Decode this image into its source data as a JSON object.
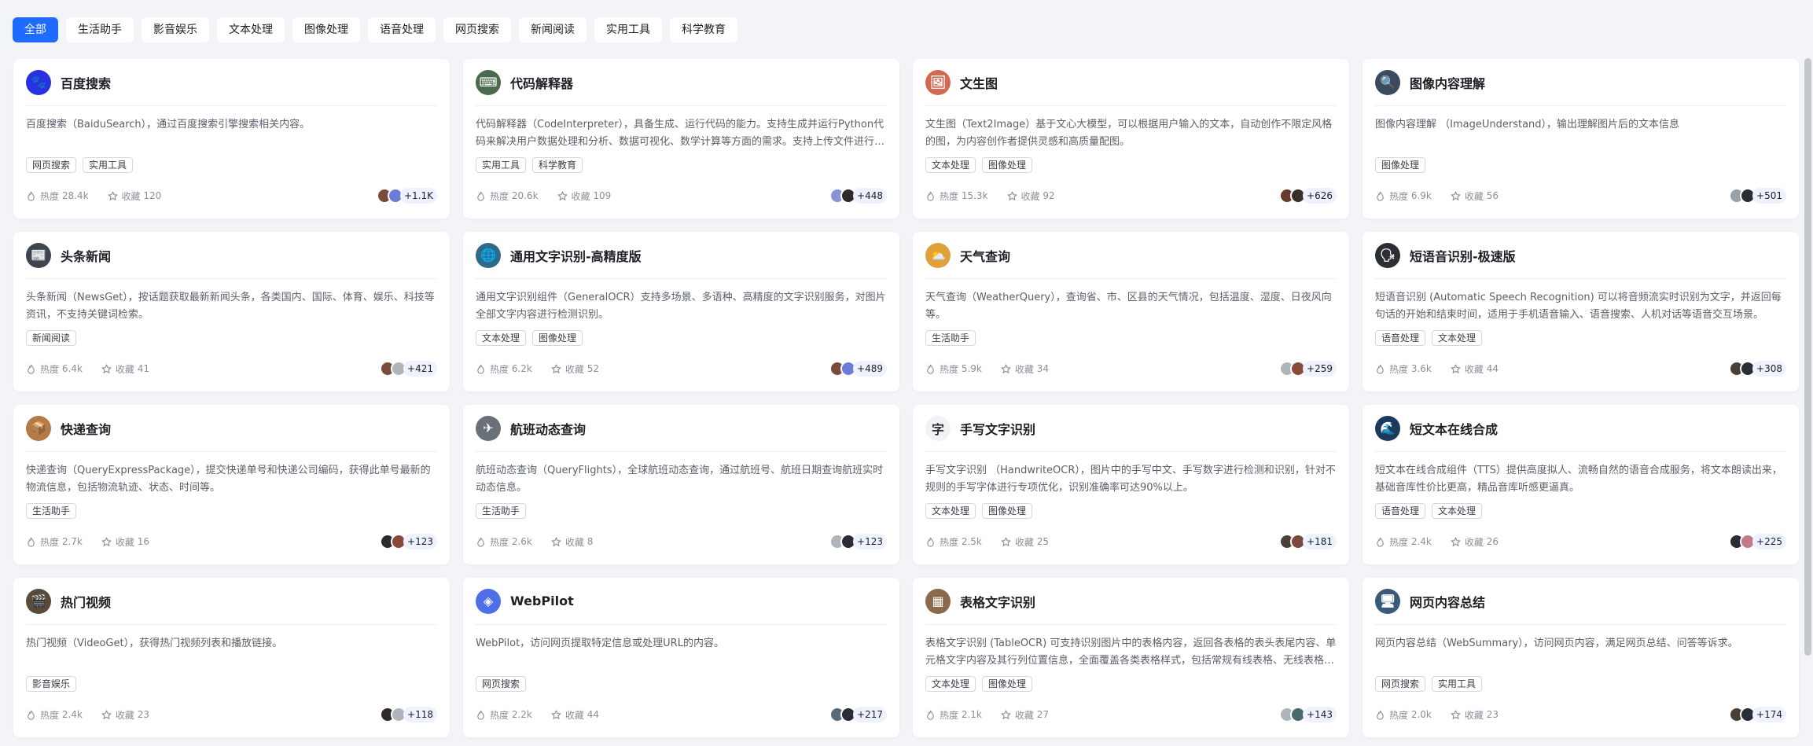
{
  "tabs": [
    {
      "label": "全部",
      "active": true
    },
    {
      "label": "生活助手"
    },
    {
      "label": "影音娱乐"
    },
    {
      "label": "文本处理"
    },
    {
      "label": "图像处理"
    },
    {
      "label": "语音处理"
    },
    {
      "label": "网页搜索"
    },
    {
      "label": "新闻阅读"
    },
    {
      "label": "实用工具"
    },
    {
      "label": "科学教育"
    }
  ],
  "heat_label": "热度",
  "fav_label": "收藏",
  "cards": [
    {
      "name": "百度搜索",
      "desc": "百度搜索（BaiduSearch），通过百度搜索引擎搜索相关内容。",
      "tags": [
        "网页搜索",
        "实用工具"
      ],
      "heat": "28.4k",
      "fav": "120",
      "more": "+1.1K",
      "icon": "paw-icon",
      "color": "#2932e1",
      "glyph": "🐾",
      "avs": [
        "#7a4a3a",
        "#6c7bd8"
      ]
    },
    {
      "name": "代码解释器",
      "desc": "代码解释器（CodeInterpreter），具备生成、运行代码的能力。支持生成并运行Python代码来解决用户数据处理和分析、数据可视化、数学计算等方面的需求。支持上传文件进行处理。",
      "tags": [
        "实用工具",
        "科学教育"
      ],
      "heat": "20.6k",
      "fav": "109",
      "more": "+448",
      "icon": "code-icon",
      "color": "#4a6a4e",
      "glyph": "⌨",
      "avs": [
        "#8a92d8",
        "#2f2a28"
      ]
    },
    {
      "name": "文生图",
      "desc": "文生图（Text2Image）基于文心大模型，可以根据用户输入的文本，自动创作不限定风格的图，为内容创作者提供灵感和高质量配图。",
      "tags": [
        "文本处理",
        "图像处理"
      ],
      "heat": "15.3k",
      "fav": "92",
      "more": "+626",
      "icon": "picture-icon",
      "color": "#d16a54",
      "glyph": "🖼",
      "avs": [
        "#6b3b2a",
        "#3a2e2a"
      ]
    },
    {
      "name": "图像内容理解",
      "desc": "图像内容理解 （ImageUnderstand），输出理解图片后的文本信息",
      "tags": [
        "图像处理"
      ],
      "heat": "6.9k",
      "fav": "56",
      "more": "+501",
      "icon": "magnifier-icon",
      "color": "#3b4a5c",
      "glyph": "🔍",
      "avs": [
        "#9aa0a8",
        "#2a2d33"
      ]
    },
    {
      "name": "头条新闻",
      "desc": "头条新闻（NewsGet），按话题获取最新新闻头条，各类国内、国际、体育、娱乐、科技等资讯，不支持关键词检索。",
      "tags": [
        "新闻阅读"
      ],
      "heat": "6.4k",
      "fav": "41",
      "more": "+421",
      "icon": "newspaper-icon",
      "color": "#3d4550",
      "glyph": "📰",
      "avs": [
        "#7a4a3a",
        "#b0b4bb"
      ]
    },
    {
      "name": "通用文字识别-高精度版",
      "desc": "通用文字识别组件（GeneralOCR）支持多场景、多语种、高精度的文字识别服务，对图片全部文字内容进行检测识别。",
      "tags": [
        "文本处理",
        "图像处理"
      ],
      "heat": "6.2k",
      "fav": "52",
      "more": "+489",
      "icon": "globe-icon",
      "color": "#2e6a8a",
      "glyph": "🌐",
      "avs": [
        "#7a4a3a",
        "#6c7bd8"
      ]
    },
    {
      "name": "天气查询",
      "desc": "天气查询（WeatherQuery），查询省、市、区县的天气情况，包括温度、湿度、日夜风向等。",
      "tags": [
        "生活助手"
      ],
      "heat": "5.9k",
      "fav": "34",
      "more": "+259",
      "icon": "weather-icon",
      "color": "#e0a03a",
      "glyph": "⛅",
      "avs": [
        "#b0b4bb",
        "#8a4a3a"
      ]
    },
    {
      "name": "短语音识别-极速版",
      "desc": "短语音识别 (Automatic Speech Recognition) 可以将音频流实时识别为文字，并返回每句话的开始和结束时间，适用于手机语音输入、语音搜索、人机对话等语音交互场景。",
      "tags": [
        "语音处理",
        "文本处理"
      ],
      "heat": "3.6k",
      "fav": "44",
      "more": "+308",
      "icon": "speech-icon",
      "color": "#2b2e33",
      "glyph": "🗣",
      "avs": [
        "#4a4038",
        "#2a2d33"
      ]
    },
    {
      "name": "快递查询",
      "desc": "快递查询（QueryExpressPackage），提交快递单号和快递公司编码，获得此单号最新的物流信息，包括物流轨迹、状态、时间等。",
      "tags": [
        "生活助手"
      ],
      "heat": "2.7k",
      "fav": "16",
      "more": "+123",
      "icon": "package-icon",
      "color": "#b57a45",
      "glyph": "📦",
      "avs": [
        "#2f2a28",
        "#8a4a3a"
      ]
    },
    {
      "name": "航班动态查询",
      "desc": "航班动态查询（QueryFlights），全球航班动态查询，通过航班号、航班日期查询航班实时动态信息。",
      "tags": [
        "生活助手"
      ],
      "heat": "2.6k",
      "fav": "8",
      "more": "+123",
      "icon": "airplane-icon",
      "color": "#6a7078",
      "glyph": "✈",
      "avs": [
        "#b0b4bb",
        "#2a2d33"
      ]
    },
    {
      "name": "手写文字识别",
      "desc": "手写文字识别 （HandwriteOCR），图片中的手写中文、手写数字进行检测和识别，针对不规则的手写字体进行专项优化，识别准确率可达90%以上。",
      "tags": [
        "文本处理",
        "图像处理"
      ],
      "heat": "2.5k",
      "fav": "25",
      "more": "+181",
      "icon": "handwriting-icon",
      "color": "#f1f2f5",
      "glyph": "字",
      "avs": [
        "#4a4038",
        "#7a4a3a"
      ]
    },
    {
      "name": "短文本在线合成",
      "desc": "短文本在线合成组件（TTS）提供高度拟人、流畅自然的语音合成服务，将文本朗读出来，基础音库性价比更高，精品音库听感更逼真。",
      "tags": [
        "语音处理",
        "文本处理"
      ],
      "heat": "2.4k",
      "fav": "26",
      "more": "+225",
      "icon": "wave-icon",
      "color": "#1d3a5c",
      "glyph": "🌊",
      "avs": [
        "#2a2d33",
        "#c07a8a"
      ]
    },
    {
      "name": "热门视频",
      "desc": "热门视频（VideoGet），获得热门视频列表和播放链接。",
      "tags": [
        "影音娱乐"
      ],
      "heat": "2.4k",
      "fav": "23",
      "more": "+118",
      "icon": "film-icon",
      "color": "#5a4a3a",
      "glyph": "🎬",
      "avs": [
        "#2f2a28",
        "#b0b4bb"
      ]
    },
    {
      "name": "WebPilot",
      "desc": "WebPilot，访问网页提取特定信息或处理URL的内容。",
      "tags": [
        "网页搜索"
      ],
      "heat": "2.2k",
      "fav": "44",
      "more": "+217",
      "icon": "diamond-icon",
      "color": "#4f6fe8",
      "glyph": "◈",
      "avs": [
        "#5a6b7a",
        "#2a2d33"
      ]
    },
    {
      "name": "表格文字识别",
      "desc": "表格文字识别 (TableOCR) 可支持识别图片中的表格内容，返回各表格的表头表尾内容、单元格文字内容及其行列位置信息，全面覆盖各类表格样式，包括常规有线表格、无线表格、含合并单元格表格。",
      "tags": [
        "文本处理",
        "图像处理"
      ],
      "heat": "2.1k",
      "fav": "27",
      "more": "+143",
      "icon": "table-icon",
      "color": "#8a6a4a",
      "glyph": "▦",
      "avs": [
        "#b0b4bb",
        "#4a6a6a"
      ]
    },
    {
      "name": "网页内容总结",
      "desc": "网页内容总结（WebSummary），访问网页内容，满足网页总结、问答等诉求。",
      "tags": [
        "网页搜索",
        "实用工具"
      ],
      "heat": "2.0k",
      "fav": "23",
      "more": "+174",
      "icon": "webpage-icon",
      "color": "#3a5a7a",
      "glyph": "🖥",
      "avs": [
        "#4a4038",
        "#2a2d33"
      ]
    }
  ]
}
